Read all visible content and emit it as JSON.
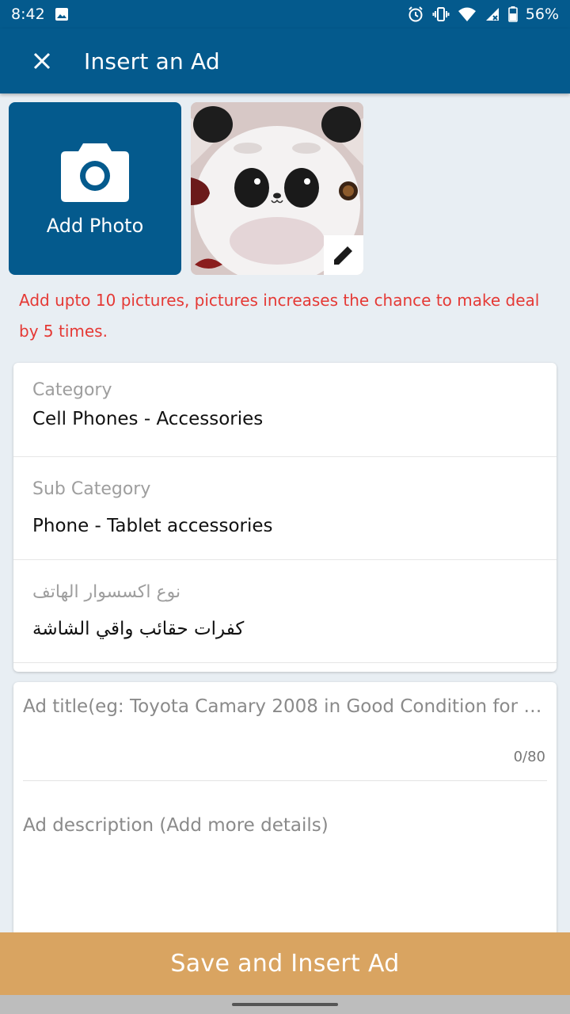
{
  "status": {
    "time": "8:42",
    "battery": "56%"
  },
  "header": {
    "title": "Insert an Ad"
  },
  "photos": {
    "add_label": "Add Photo"
  },
  "hint": "Add upto 10 pictures, pictures increases the chance to make deal by 5 times.",
  "fields": {
    "category": {
      "label": "Category",
      "value": "Cell Phones - Accessories"
    },
    "subcategory": {
      "label": "Sub Category",
      "value": "Phone - Tablet accessories"
    },
    "accessory_type": {
      "label": "نوع اكسسوار الهاتف",
      "value": "كفرات حقائب واقي الشاشة"
    }
  },
  "ad": {
    "title_placeholder": "Ad title(eg: Toyota Camary 2008 in Good Condition for …",
    "counter": "0/80",
    "description_placeholder": "Ad description (Add more details)"
  },
  "footer": {
    "save_label": "Save and Insert Ad"
  },
  "colors": {
    "primary": "#045a8d",
    "accent": "#d9a461",
    "hint": "#e53935"
  }
}
